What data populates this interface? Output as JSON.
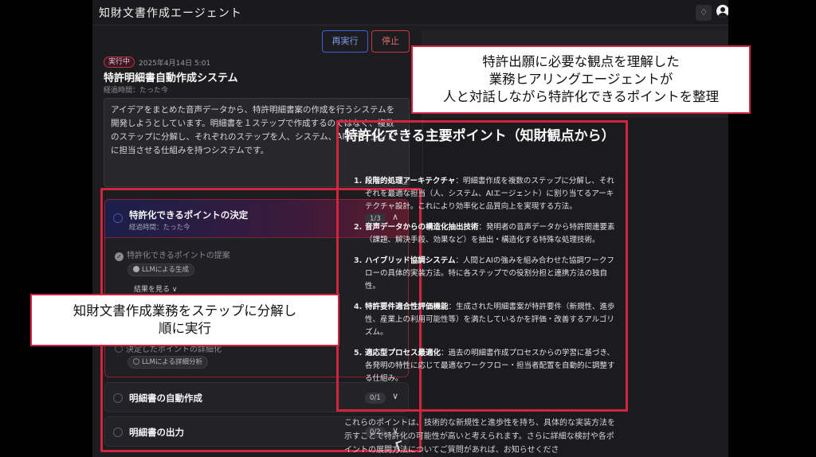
{
  "header": {
    "app_title": "知財文書作成エージェント",
    "bell_icon": "bell-icon",
    "avatar_icon": "user-avatar-icon"
  },
  "controls": {
    "rerun_label": "再実行",
    "stop_label": "停止"
  },
  "job": {
    "status": "実行中",
    "timestamp": "2025年4月14日 5:01",
    "title": "特許明細書自動作成システム",
    "elapsed": "経過時間：たった今",
    "prompt": "アイデアをまとめた音声データから、特許明細書案の作成を行うシステムを開発しようとしています。明細書を１ステップで作成するのではなく、複数のステップに分解し、それぞれのステップを人、システム、AIエージェントに担当させる仕組みを持つシステムです。"
  },
  "steps": [
    {
      "title": "特許化できるポイントの決定",
      "elapsed": "経過時間：たった今",
      "count": "1/3",
      "substeps": [
        {
          "label": "特許化できるポイントの提案",
          "pill": "LLMによる生成",
          "result_toggle": "結果を見る ∨"
        },
        {
          "label": "決定したポイントの詳細化",
          "pill": "LLMによる詳細分析"
        }
      ]
    },
    {
      "title": "明細書の自動作成",
      "count": "0/1"
    },
    {
      "title": "明細書の出力",
      "count": "0/2"
    }
  ],
  "points": {
    "heading": "特許化できる主要ポイント（知財観点から）",
    "items": [
      {
        "num": "1.",
        "term": "段階的処理アーキテクチャ",
        "desc": "：明細書作成を複数のステップに分解し、それぞれを最適な担当（人、システム、AIエージェント）に割り当てるアーキテクチャ設計。これにより効率化と品質向上を実現する方法。"
      },
      {
        "num": "2.",
        "term": "音声データからの構造化抽出技術",
        "desc": "：発明者の音声データから特許関連要素（課題、解決手段、効果など）を抽出・構造化する特殊な処理技術。"
      },
      {
        "num": "3.",
        "term": "ハイブリッド協調システム",
        "desc": "：人間とAIの強みを組み合わせた協調ワークフローの具体的実装方法。特に各ステップでの役割分担と連携方法の独自性。"
      },
      {
        "num": "4.",
        "term": "特許要件適合性評価機能",
        "desc": "：生成された明細書案が特許要件（新規性、進歩性、産業上の利用可能性等）を満たしているかを評価・改善するアルゴリズム。"
      },
      {
        "num": "5.",
        "term": "適応型プロセス最適化",
        "desc": "：過去の明細書作成プロセスからの学習に基づき、各発明の特性に応じて最適なワークフロー・担当者配置を自動的に調整する仕組み。"
      }
    ],
    "summary": "これらのポイントは、技術的な新規性と進歩性を持ち、具体的な実装方法を示すことで特許化の可能性が高いと考えられます。さらに詳細な検討や各ポイントの展開方法についてご質問があれば、お知らせくださ"
  },
  "callouts": {
    "left": "知財文書作成業務をステップに分解し\n順に実行",
    "right": "特許出願に必要な観点を理解した\n業務ヒアリングエージェントが\n人と対話しながら特許化できるポイントを整理"
  }
}
